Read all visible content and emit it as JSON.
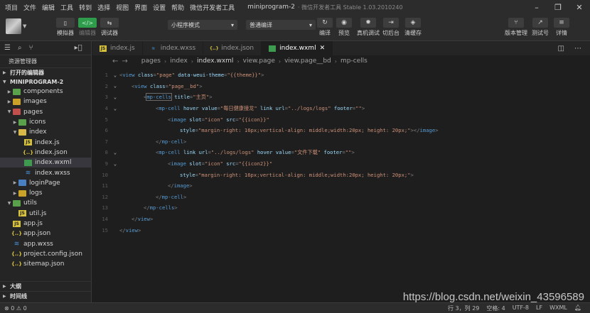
{
  "menubar": {
    "items": [
      "项目",
      "文件",
      "编辑",
      "工具",
      "转到",
      "选择",
      "视图",
      "界面",
      "设置",
      "帮助",
      "微信开发者工具"
    ],
    "app_title": "miniprogram-2",
    "app_subtitle": "· 微信开发者工具 Stable 1.03.2010240",
    "window_controls": [
      "–",
      "❐",
      "✕"
    ]
  },
  "toolbar": {
    "simulator": "模拟器",
    "editor": "编辑器",
    "debugger": "调试器",
    "mode_select": "小程序模式",
    "compile_select": "普通编译",
    "compile": "编译",
    "preview": "预览",
    "real_debug": "真机调试",
    "background": "切后台",
    "clear_cache": "清缓存",
    "version_mgmt": "版本管理",
    "test_id": "测试号",
    "details": "详情"
  },
  "sidebar": {
    "title": "资源管理器",
    "open_editors": "打开的编辑器",
    "project": "MINIPROGRAM-2",
    "tree": [
      {
        "label": "components",
        "indent": 1,
        "type": "folder-green",
        "arrow": "▶"
      },
      {
        "label": "images",
        "indent": 1,
        "type": "folder",
        "arrow": "▶"
      },
      {
        "label": "pages",
        "indent": 1,
        "type": "folder-red",
        "arrow": "▼"
      },
      {
        "label": "icons",
        "indent": 2,
        "type": "folder-green",
        "arrow": "▶"
      },
      {
        "label": "index",
        "indent": 2,
        "type": "folder-open",
        "arrow": "▼"
      },
      {
        "label": "index.js",
        "indent": 3,
        "type": "js",
        "arrow": ""
      },
      {
        "label": "index.json",
        "indent": 3,
        "type": "json",
        "arrow": ""
      },
      {
        "label": "index.wxml",
        "indent": 3,
        "type": "wxml",
        "arrow": "",
        "selected": true
      },
      {
        "label": "index.wxss",
        "indent": 3,
        "type": "wxss",
        "arrow": ""
      },
      {
        "label": "loginPage",
        "indent": 2,
        "type": "folder-blue",
        "arrow": "▶"
      },
      {
        "label": "logs",
        "indent": 2,
        "type": "folder",
        "arrow": "▶"
      },
      {
        "label": "utils",
        "indent": 1,
        "type": "folder-green",
        "arrow": "▼"
      },
      {
        "label": "util.js",
        "indent": 2,
        "type": "js",
        "arrow": ""
      },
      {
        "label": "app.js",
        "indent": 1,
        "type": "js",
        "arrow": ""
      },
      {
        "label": "app.json",
        "indent": 1,
        "type": "json",
        "arrow": ""
      },
      {
        "label": "app.wxss",
        "indent": 1,
        "type": "wxss",
        "arrow": ""
      },
      {
        "label": "project.config.json",
        "indent": 1,
        "type": "json",
        "arrow": ""
      },
      {
        "label": "sitemap.json",
        "indent": 1,
        "type": "json",
        "arrow": ""
      }
    ],
    "outline": "大纲",
    "timeline": "时间线"
  },
  "tabs": [
    {
      "label": "index.js",
      "type": "js"
    },
    {
      "label": "index.wxss",
      "type": "wxss"
    },
    {
      "label": "index.json",
      "type": "json"
    },
    {
      "label": "index.wxml",
      "type": "wxml",
      "active": true
    }
  ],
  "breadcrumb": [
    "pages",
    "index",
    "index.wxml",
    "view.page",
    "view.page__bd",
    "mp-cells"
  ],
  "code": [
    {
      "n": "1",
      "fold": "⌄",
      "indent": 0,
      "segs": [
        [
          "p",
          "<"
        ],
        [
          "t",
          "view"
        ],
        [
          "a",
          " class"
        ],
        [
          "p",
          "="
        ],
        [
          "s",
          "\"page\""
        ],
        [
          "a",
          " data-weui-theme"
        ],
        [
          "p",
          "="
        ],
        [
          "s",
          "\"{{theme}}\""
        ],
        [
          "p",
          ">"
        ]
      ]
    },
    {
      "n": "2",
      "fold": "⌄",
      "indent": 1,
      "segs": [
        [
          "p",
          "<"
        ],
        [
          "t",
          "view"
        ],
        [
          "a",
          " class"
        ],
        [
          "p",
          "="
        ],
        [
          "s",
          "\"page__bd\""
        ],
        [
          "p",
          ">"
        ]
      ]
    },
    {
      "n": "3",
      "fold": "⌄",
      "indent": 2,
      "segs": [
        [
          "p",
          "<"
        ],
        [
          "t",
          "mp-cells"
        ],
        [
          "a",
          " title"
        ],
        [
          "p",
          "="
        ],
        [
          "s",
          "\"主页\""
        ],
        [
          "p",
          ">"
        ]
      ]
    },
    {
      "n": "4",
      "fold": "⌄",
      "indent": 3,
      "segs": [
        [
          "p",
          "<"
        ],
        [
          "t",
          "mp-cell"
        ],
        [
          "a",
          " hover value"
        ],
        [
          "p",
          "="
        ],
        [
          "s",
          "\"每日健康接龙\""
        ],
        [
          "a",
          " link url"
        ],
        [
          "p",
          "="
        ],
        [
          "s",
          "\"../logs/logs\""
        ],
        [
          "a",
          " footer"
        ],
        [
          "p",
          "="
        ],
        [
          "s",
          "\"\""
        ],
        [
          "p",
          ">"
        ]
      ]
    },
    {
      "n": "5",
      "fold": "",
      "indent": 4,
      "segs": [
        [
          "p",
          "<"
        ],
        [
          "t",
          "image"
        ],
        [
          "a",
          " slot"
        ],
        [
          "p",
          "="
        ],
        [
          "s",
          "\"icon\""
        ],
        [
          "a",
          " src"
        ],
        [
          "p",
          "="
        ],
        [
          "s",
          "\"{{icon}}\""
        ]
      ]
    },
    {
      "n": "6",
      "fold": "",
      "indent": 5,
      "segs": [
        [
          "a",
          "style"
        ],
        [
          "p",
          "="
        ],
        [
          "s",
          "\"margin-right: 16px;vertical-align: middle;width:20px; height: 20px;\""
        ],
        [
          "p",
          "></"
        ],
        [
          "t",
          "image"
        ],
        [
          "p",
          ">"
        ]
      ]
    },
    {
      "n": "7",
      "fold": "",
      "indent": 3,
      "segs": [
        [
          "p",
          "</"
        ],
        [
          "t",
          "mp-cell"
        ],
        [
          "p",
          ">"
        ]
      ]
    },
    {
      "n": "8",
      "fold": "⌄",
      "indent": 3,
      "segs": [
        [
          "p",
          "<"
        ],
        [
          "t",
          "mp-cell"
        ],
        [
          "a",
          " link url"
        ],
        [
          "p",
          "="
        ],
        [
          "s",
          "\"../logs/logs\""
        ],
        [
          "a",
          " hover value"
        ],
        [
          "p",
          "="
        ],
        [
          "s",
          "\"文件下载\""
        ],
        [
          "a",
          " footer"
        ],
        [
          "p",
          "="
        ],
        [
          "s",
          "\"\""
        ],
        [
          "p",
          ">"
        ]
      ]
    },
    {
      "n": "9",
      "fold": "⌄",
      "indent": 4,
      "segs": [
        [
          "p",
          "<"
        ],
        [
          "t",
          "image"
        ],
        [
          "a",
          " slot"
        ],
        [
          "p",
          "="
        ],
        [
          "s",
          "\"icon\""
        ],
        [
          "a",
          " src"
        ],
        [
          "p",
          "="
        ],
        [
          "s",
          "\"{{icon2}}\""
        ]
      ]
    },
    {
      "n": "10",
      "fold": "",
      "indent": 5,
      "segs": [
        [
          "a",
          "style"
        ],
        [
          "p",
          "="
        ],
        [
          "s",
          "\"margin-right: 16px;vertical-align: middle;width:20px; height: 20px;\""
        ],
        [
          "p",
          ">"
        ]
      ]
    },
    {
      "n": "11",
      "fold": "",
      "indent": 4,
      "segs": [
        [
          "p",
          "</"
        ],
        [
          "t",
          "image"
        ],
        [
          "p",
          ">"
        ]
      ]
    },
    {
      "n": "12",
      "fold": "",
      "indent": 3,
      "segs": [
        [
          "p",
          "</"
        ],
        [
          "t",
          "mp-cell"
        ],
        [
          "p",
          ">"
        ]
      ]
    },
    {
      "n": "13",
      "fold": "",
      "indent": 2,
      "segs": [
        [
          "p",
          "</"
        ],
        [
          "t",
          "mp-cells"
        ],
        [
          "p",
          ">"
        ]
      ]
    },
    {
      "n": "14",
      "fold": "",
      "indent": 1,
      "segs": [
        [
          "p",
          "</"
        ],
        [
          "t",
          "view"
        ],
        [
          "p",
          ">"
        ]
      ]
    },
    {
      "n": "15",
      "fold": "",
      "indent": 0,
      "segs": [
        [
          "p",
          "</"
        ],
        [
          "t",
          "view"
        ],
        [
          "p",
          ">"
        ]
      ]
    }
  ],
  "watermark": "https://blog.csdn.net/weixin_43596589",
  "statusbar": {
    "problems": "⊗ 0 ⚠ 0",
    "position": "行 3，列 29",
    "spaces": "空格: 4",
    "encoding": "UTF-8",
    "eol": "LF",
    "language": "WXML"
  }
}
